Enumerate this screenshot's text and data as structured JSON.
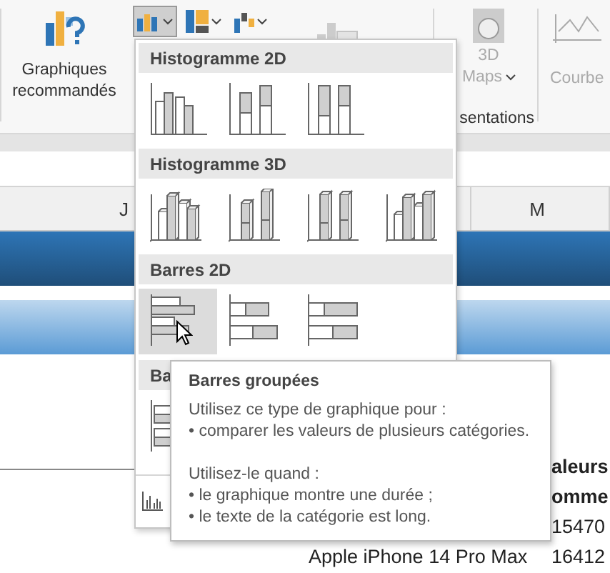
{
  "ribbon": {
    "recommended_label": "Graphiques recommandés",
    "chart_buttons": [
      {
        "kind": "column",
        "selected": true
      },
      {
        "kind": "hierarchy",
        "selected": false
      },
      {
        "kind": "waterfall",
        "selected": false
      }
    ],
    "pivot_chart": {
      "disabled": true
    },
    "maps": {
      "label": "3D",
      "sublabel": "Maps",
      "disabled": true
    },
    "group_label": "sentations",
    "sparkline_label": "Courbe"
  },
  "columns": [
    {
      "label": "J"
    },
    {
      "label": "M"
    }
  ],
  "menu": {
    "sections": [
      {
        "title": "Histogramme 2D",
        "items": [
          {
            "kind": "col-clustered",
            "selected": false
          },
          {
            "kind": "col-stacked",
            "selected": false
          },
          {
            "kind": "col-stacked100",
            "selected": false
          }
        ]
      },
      {
        "title": "Histogramme 3D",
        "items": [
          {
            "kind": "col3d-clustered",
            "selected": false
          },
          {
            "kind": "col3d-stacked",
            "selected": false
          },
          {
            "kind": "col3d-stacked100",
            "selected": false
          },
          {
            "kind": "col3d",
            "selected": false
          }
        ]
      },
      {
        "title": "Barres 2D",
        "items": [
          {
            "kind": "bar-clustered",
            "selected": true
          },
          {
            "kind": "bar-stacked",
            "selected": false
          },
          {
            "kind": "bar-stacked100",
            "selected": false
          }
        ]
      },
      {
        "title": "Ba",
        "items": [
          {
            "kind": "bar3d-clustered",
            "selected": false
          }
        ]
      }
    ]
  },
  "tooltip": {
    "title": "Barres groupées",
    "paragraphs": [
      [
        "Utilisez ce type de graphique pour :",
        "• comparer les valeurs de plusieurs catégories."
      ],
      [
        "Utilisez-le quand :",
        "• le graphique montre une durée ;",
        "• le texte de la catégorie est long."
      ]
    ]
  },
  "cells": [
    {
      "kind": "header",
      "value": "aleurs"
    },
    {
      "kind": "header",
      "value": "omme"
    },
    {
      "kind": "data",
      "value": "15470"
    },
    {
      "kind": "data",
      "label": "Apple iPhone 14 Pro Max",
      "value": "16412"
    }
  ]
}
